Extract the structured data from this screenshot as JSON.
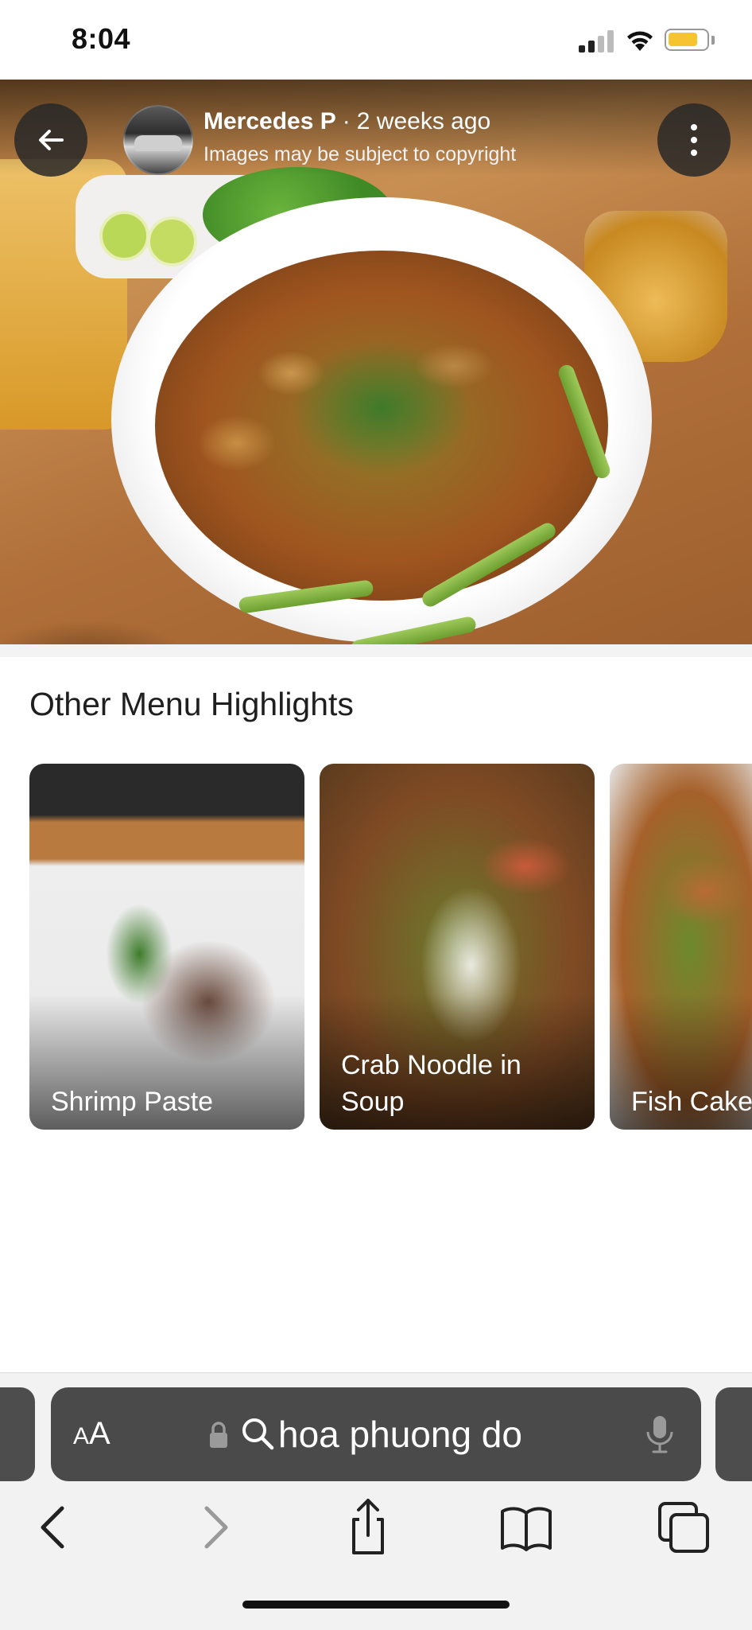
{
  "status_bar": {
    "time": "8:04",
    "signal_icon": "cellular-signal-icon",
    "wifi_icon": "wifi-icon",
    "battery_icon": "battery-icon",
    "battery_color": "#f6c431",
    "battery_level": 0.8
  },
  "photo_viewer": {
    "back_icon": "arrow-left-icon",
    "author_name": "Mercedes P",
    "separator": "·",
    "posted_ago": "2 weeks ago",
    "copyright_notice": "Images may be subject to copyright",
    "more_icon": "more-vertical-icon"
  },
  "highlights": {
    "title": "Other Menu Highlights",
    "items": [
      {
        "label": "Shrimp Paste"
      },
      {
        "label": "Crab Noodle in Soup"
      },
      {
        "label": "Fish Cake Noodles"
      }
    ]
  },
  "browser": {
    "text_size_label_large": "A",
    "text_size_label_small": "A",
    "lock_icon": "lock-icon",
    "search_icon": "search-icon",
    "address_text": "hoa phuong do",
    "mic_icon": "microphone-icon",
    "toolbar": {
      "back_icon": "chevron-left-icon",
      "forward_icon": "chevron-right-icon",
      "share_icon": "share-icon",
      "bookmarks_icon": "book-icon",
      "tabs_icon": "tabs-icon"
    }
  }
}
